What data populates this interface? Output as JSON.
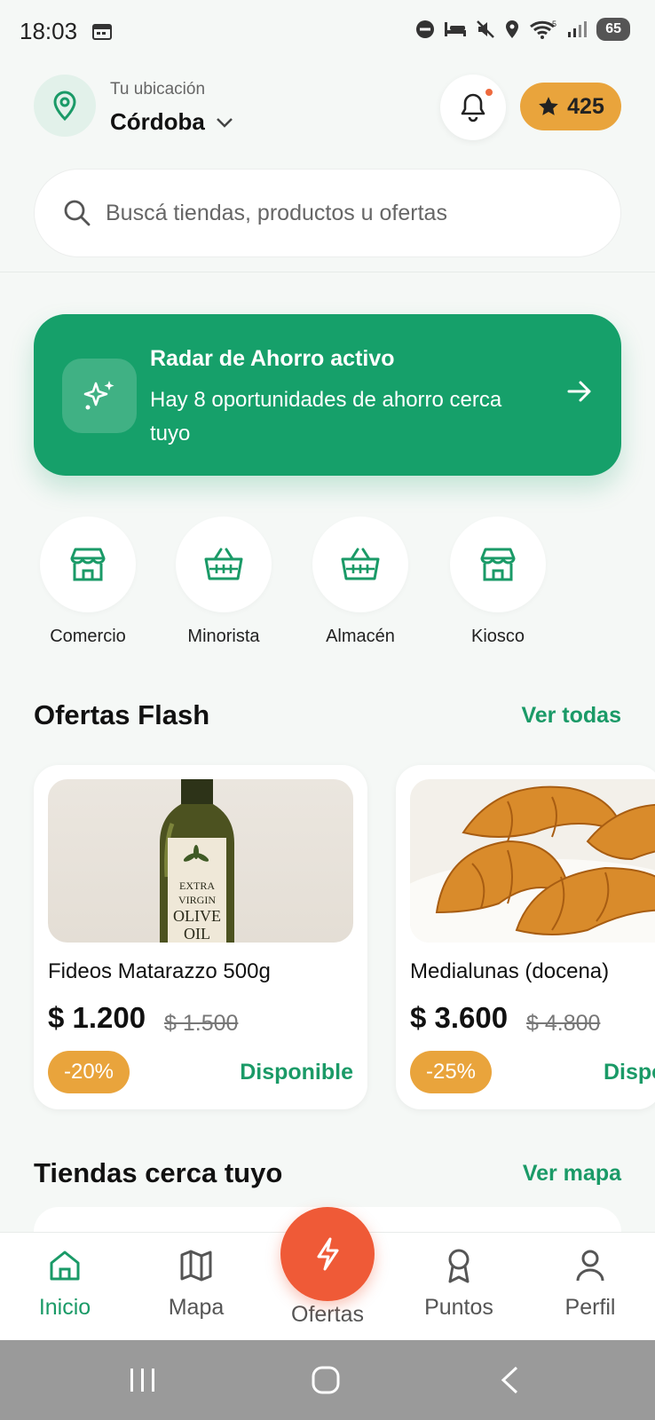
{
  "status_bar": {
    "time": "18:03",
    "battery": "65"
  },
  "header": {
    "location_label": "Tu ubicación",
    "city": "Córdoba",
    "points": "425"
  },
  "search": {
    "placeholder": "Buscá tiendas, productos u ofertas"
  },
  "radar": {
    "title": "Radar de Ahorro activo",
    "subtitle": "Hay 8 oportunidades de ahorro cerca tuyo"
  },
  "categories": [
    {
      "label": "Comercio",
      "icon": "store-icon"
    },
    {
      "label": "Minorista",
      "icon": "basket-icon"
    },
    {
      "label": "Almacén",
      "icon": "basket-icon"
    },
    {
      "label": "Kiosco",
      "icon": "store-icon"
    }
  ],
  "flash": {
    "title": "Ofertas Flash",
    "link": "Ver todas",
    "items": [
      {
        "name": "Fideos Matarazzo 500g",
        "price": "$ 1.200",
        "old_price": "$ 1.500",
        "discount": "-20%",
        "status": "Disponible",
        "bottle_text": "EXTRA VIRGIN OLIVE OIL"
      },
      {
        "name": "Medialunas (docena)",
        "price": "$ 3.600",
        "old_price": "$ 4.800",
        "discount": "-25%",
        "status": "Disponible"
      }
    ]
  },
  "stores": {
    "title": "Tiendas cerca tuyo",
    "link": "Ver mapa"
  },
  "nav": {
    "items": [
      {
        "label": "Inicio",
        "icon": "home-icon",
        "active": true
      },
      {
        "label": "Mapa",
        "icon": "map-icon"
      },
      {
        "label": "Ofertas",
        "icon": "bolt-icon"
      },
      {
        "label": "Puntos",
        "icon": "award-icon"
      },
      {
        "label": "Perfil",
        "icon": "user-icon"
      }
    ]
  },
  "colors": {
    "primary": "#16a06a",
    "accent": "#e9a43c",
    "fab": "#ef5a37"
  }
}
